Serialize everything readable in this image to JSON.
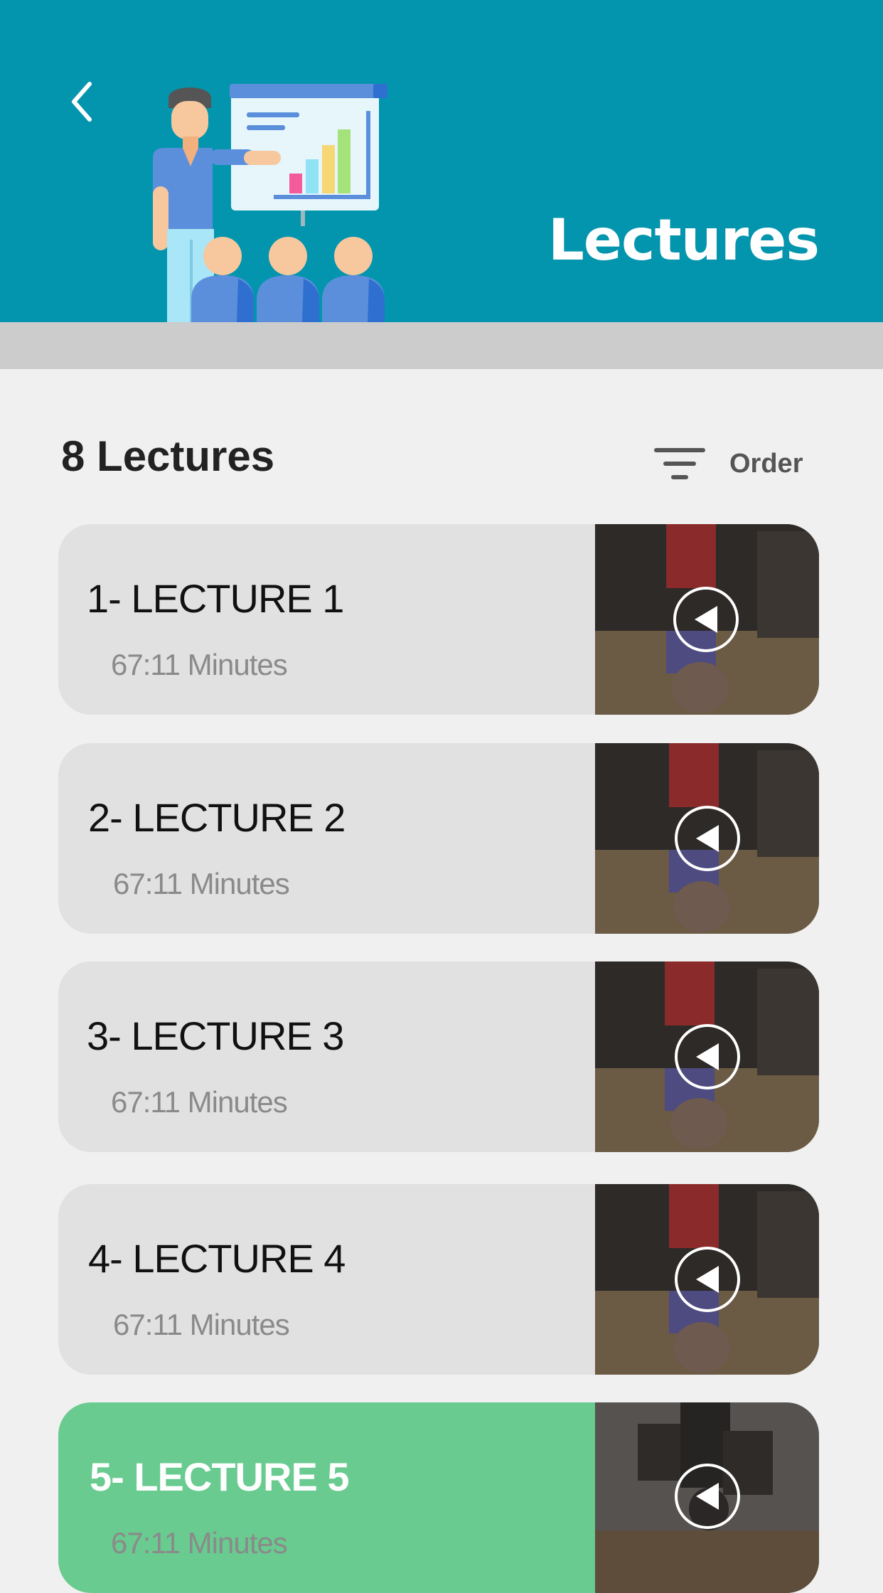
{
  "header": {
    "title": "Lectures",
    "back_icon": "chevron-left-icon",
    "background_color": "#0495ae"
  },
  "list_header": {
    "count_label": "8 Lectures",
    "order_label": "Order",
    "order_icon": "filter-icon"
  },
  "lectures": [
    {
      "title": "1- LECTURE 1",
      "duration": "67:11 Minutes",
      "active": false
    },
    {
      "title": "2- LECTURE 2",
      "duration": "67:11 Minutes",
      "active": false
    },
    {
      "title": "3- LECTURE 3",
      "duration": "67:11 Minutes",
      "active": false
    },
    {
      "title": "4- LECTURE 4",
      "duration": "67:11 Minutes",
      "active": false
    },
    {
      "title": "5- LECTURE 5",
      "duration": "67:11 Minutes",
      "active": true
    }
  ],
  "colors": {
    "card": "#e1e1e1",
    "card_active": "#69cb8f",
    "band": "#cccccc",
    "page": "#f0f0f0"
  }
}
